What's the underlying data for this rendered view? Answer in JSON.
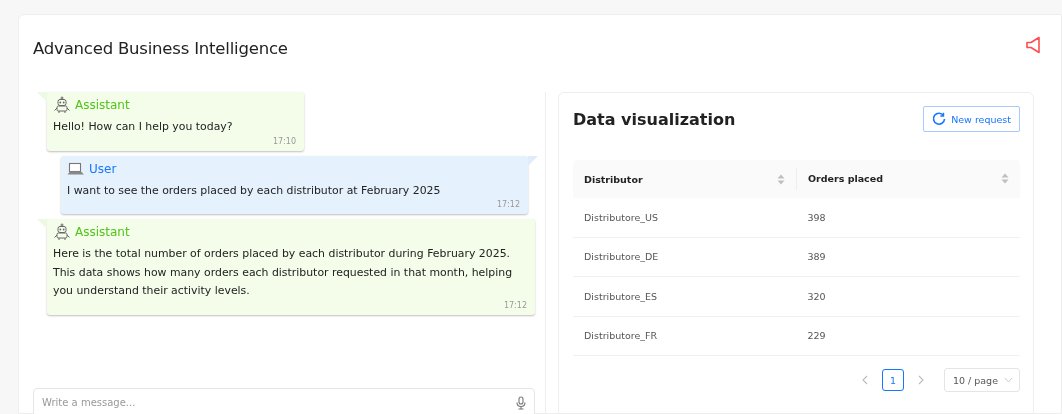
{
  "app": {
    "title": "Advanced Business Intelligence"
  },
  "messages": [
    {
      "kind": "assistant",
      "sender": "Assistant",
      "text": "Hello! How can I help you today?",
      "time": "17:10"
    },
    {
      "kind": "user",
      "sender": "User",
      "text": "I want to see the orders placed by each distributor at February 2025",
      "time": "17:12"
    },
    {
      "kind": "assistant",
      "sender": "Assistant",
      "text": "Here is the total number of orders placed by each distributor during February 2025. This data shows how many orders each distributor requested in that month, helping you understand their activity levels.",
      "time": "17:12"
    }
  ],
  "composer": {
    "placeholder": "Write a message..."
  },
  "panel": {
    "title": "Data visualization",
    "button": "New request"
  },
  "table": {
    "columns": [
      "Distributor",
      "Orders placed"
    ],
    "rows": [
      [
        "Distributore_US",
        "398"
      ],
      [
        "Distributore_DE",
        "389"
      ],
      [
        "Distributore_ES",
        "320"
      ],
      [
        "Distributore_FR",
        "229"
      ]
    ]
  },
  "pagination": {
    "pages": [
      {
        "label": "1",
        "selected": true
      }
    ],
    "page_size": "10 / page"
  }
}
